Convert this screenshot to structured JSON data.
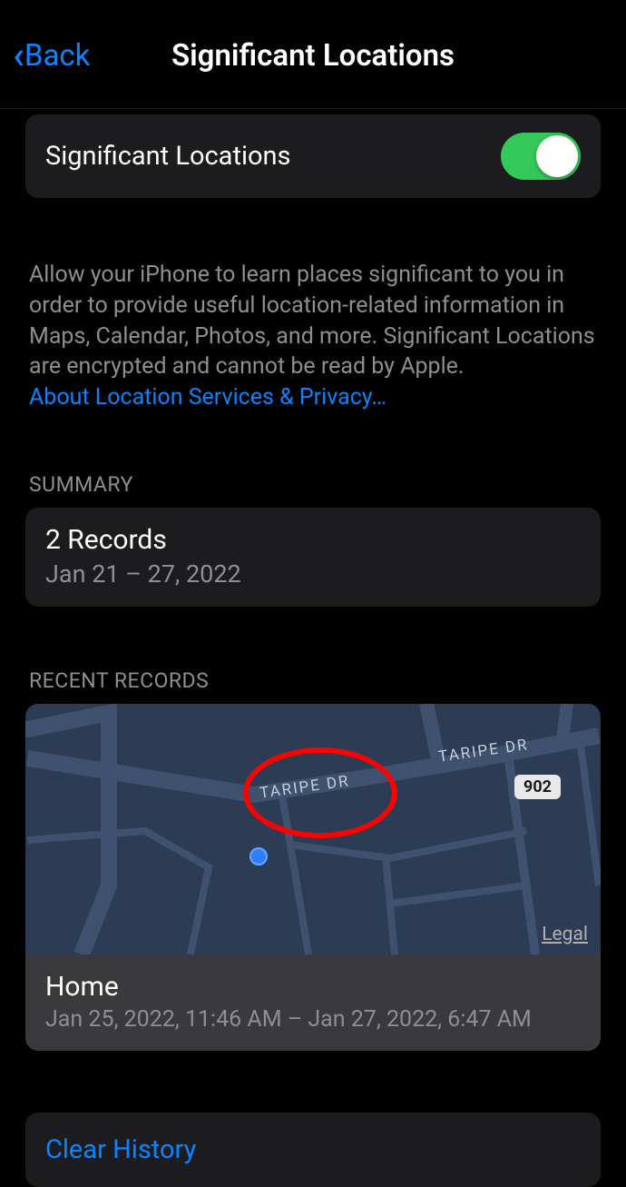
{
  "header": {
    "back_label": "Back",
    "title": "Significant Locations"
  },
  "toggle": {
    "label": "Significant Locations",
    "enabled": true
  },
  "description": {
    "text": "Allow your iPhone to learn places significant to you in order to provide useful location-related information in Maps, Calendar, Photos, and more. Significant Locations are encrypted and cannot be read by Apple.",
    "link_text": "About Location Services & Privacy…"
  },
  "summary": {
    "header": "SUMMARY",
    "title": "2 Records",
    "date_range": "Jan 21 – 27, 2022"
  },
  "recent": {
    "header": "RECENT RECORDS",
    "map": {
      "road_label_1": "TARIPE DR",
      "road_label_2": "TARIPE DR",
      "route_badge": "902",
      "legal": "Legal"
    },
    "record": {
      "title": "Home",
      "subtitle": "Jan 25, 2022, 11:46 AM – Jan 27, 2022, 6:47 AM"
    }
  },
  "clear": {
    "label": "Clear History"
  }
}
